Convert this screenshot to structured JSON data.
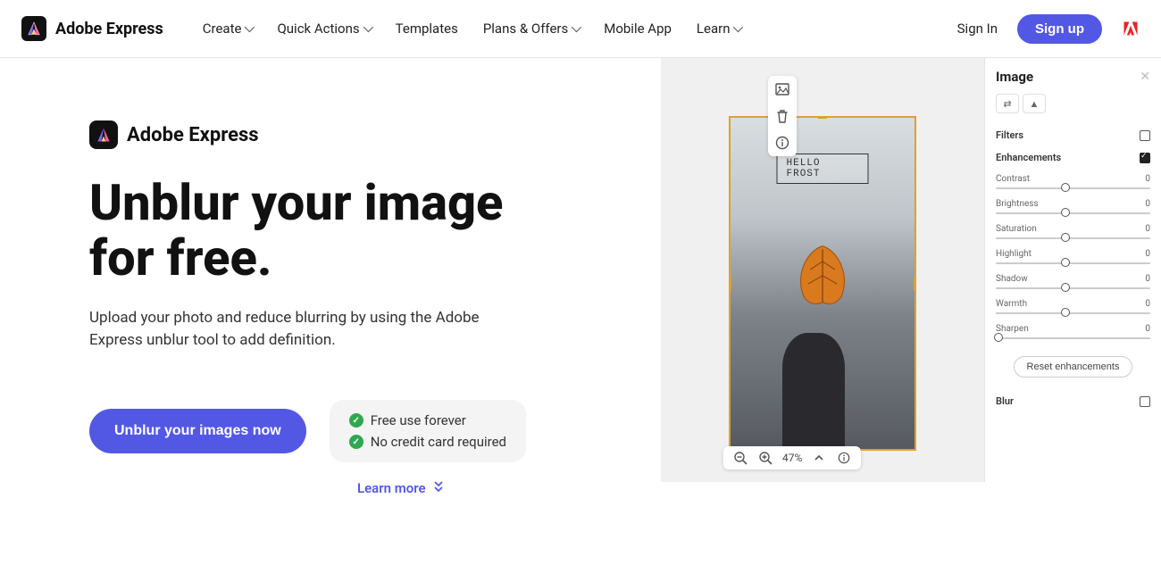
{
  "brand": {
    "name": "Adobe Express"
  },
  "nav": {
    "items": [
      {
        "label": "Create",
        "dropdown": true
      },
      {
        "label": "Quick Actions",
        "dropdown": true
      },
      {
        "label": "Templates",
        "dropdown": false
      },
      {
        "label": "Plans & Offers",
        "dropdown": true
      },
      {
        "label": "Mobile App",
        "dropdown": false
      },
      {
        "label": "Learn",
        "dropdown": true
      }
    ],
    "signin": "Sign In",
    "signup": "Sign up"
  },
  "hero": {
    "title_line1": "Unblur your image",
    "title_line2": "for free.",
    "subtitle": "Upload your photo and reduce blurring by using the Adobe Express unblur tool to add definition.",
    "cta": "Unblur your images now",
    "benefits": [
      "Free use forever",
      "No credit card required"
    ],
    "learn_more": "Learn more"
  },
  "editor": {
    "photo_caption": "HELLO FROST",
    "zoom": {
      "level": "47%"
    },
    "panel": {
      "title": "Image",
      "sections": {
        "filters": "Filters",
        "enhancements": "Enhancements",
        "blur": "Blur"
      },
      "sliders": [
        {
          "name": "Contrast",
          "value": 0,
          "pos": 45
        },
        {
          "name": "Brightness",
          "value": 0,
          "pos": 45
        },
        {
          "name": "Saturation",
          "value": 0,
          "pos": 45
        },
        {
          "name": "Highlight",
          "value": 0,
          "pos": 45
        },
        {
          "name": "Shadow",
          "value": 0,
          "pos": 45
        },
        {
          "name": "Warmth",
          "value": 0,
          "pos": 45
        },
        {
          "name": "Sharpen",
          "value": 0,
          "pos": 2
        }
      ],
      "reset": "Reset enhancements"
    }
  }
}
